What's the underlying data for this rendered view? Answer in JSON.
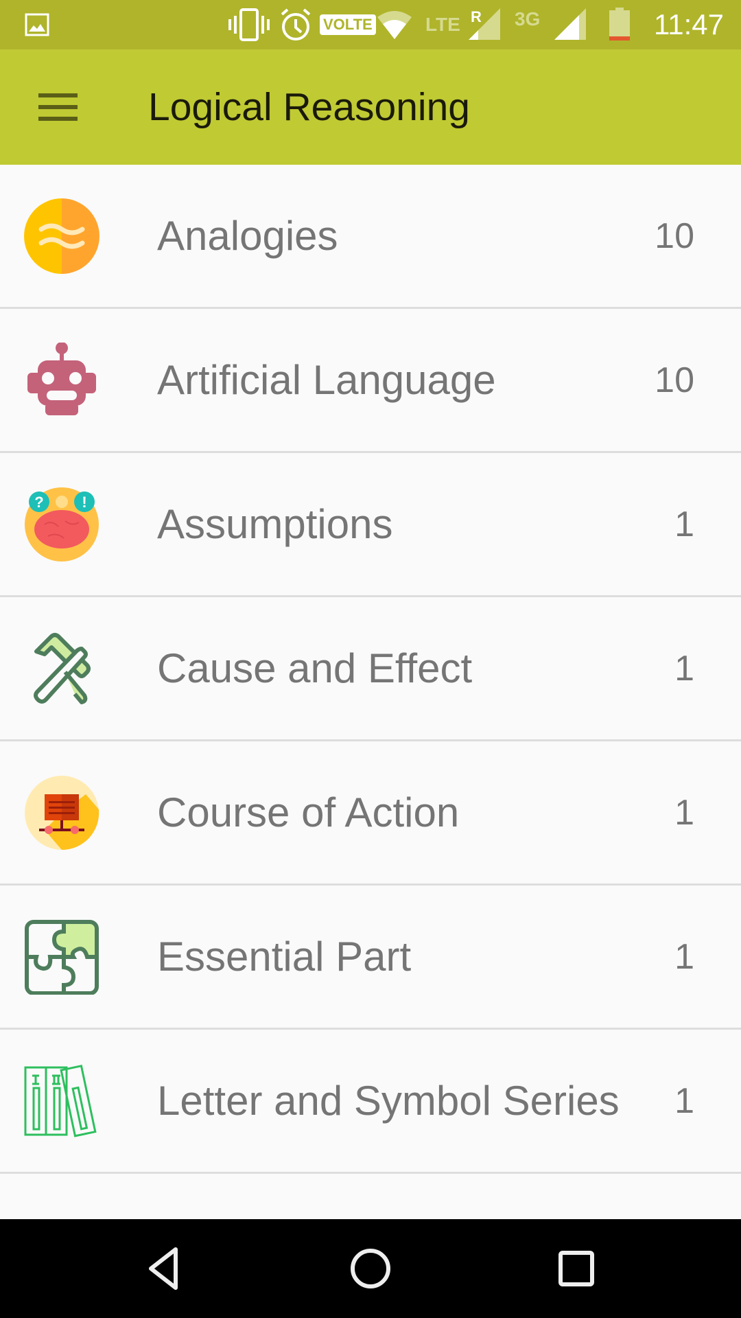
{
  "status_bar": {
    "time": "11:47",
    "volte_label": "VOLTE",
    "lte_label": "LTE",
    "roaming_label": "R",
    "network_3g_label": "3G",
    "icons": [
      "image-notification-icon",
      "vibrate-icon",
      "alarm-icon",
      "volte-icon",
      "wifi-icon",
      "lte-signal-icon",
      "3g-signal-icon",
      "battery-low-icon"
    ]
  },
  "app_bar": {
    "title": "Logical Reasoning",
    "menu_icon": "hamburger-menu-icon",
    "color": "#C0CA33"
  },
  "topics": [
    {
      "label": "Analogies",
      "count": "10",
      "icon": "analogies-icon"
    },
    {
      "label": "Artificial Language",
      "count": "10",
      "icon": "robot-icon"
    },
    {
      "label": "Assumptions",
      "count": "1",
      "icon": "brain-icon"
    },
    {
      "label": "Cause and Effect",
      "count": "1",
      "icon": "cross-tools-icon"
    },
    {
      "label": "Course of Action",
      "count": "1",
      "icon": "presentation-board-icon"
    },
    {
      "label": "Essential Part",
      "count": "1",
      "icon": "puzzle-icon"
    },
    {
      "label": "Letter and Symbol Series",
      "count": "1",
      "icon": "books-series-icon"
    },
    {
      "label": "",
      "count": "",
      "icon": "purple-partial-icon"
    }
  ],
  "nav_bar": {
    "back": "back-icon",
    "home": "home-icon",
    "recents": "recents-icon"
  },
  "colors": {
    "status_bar": "#AFB42B",
    "app_bar": "#C0CA33",
    "background": "#FAFAFA",
    "text": "#757575",
    "divider": "#DDDDDD"
  }
}
